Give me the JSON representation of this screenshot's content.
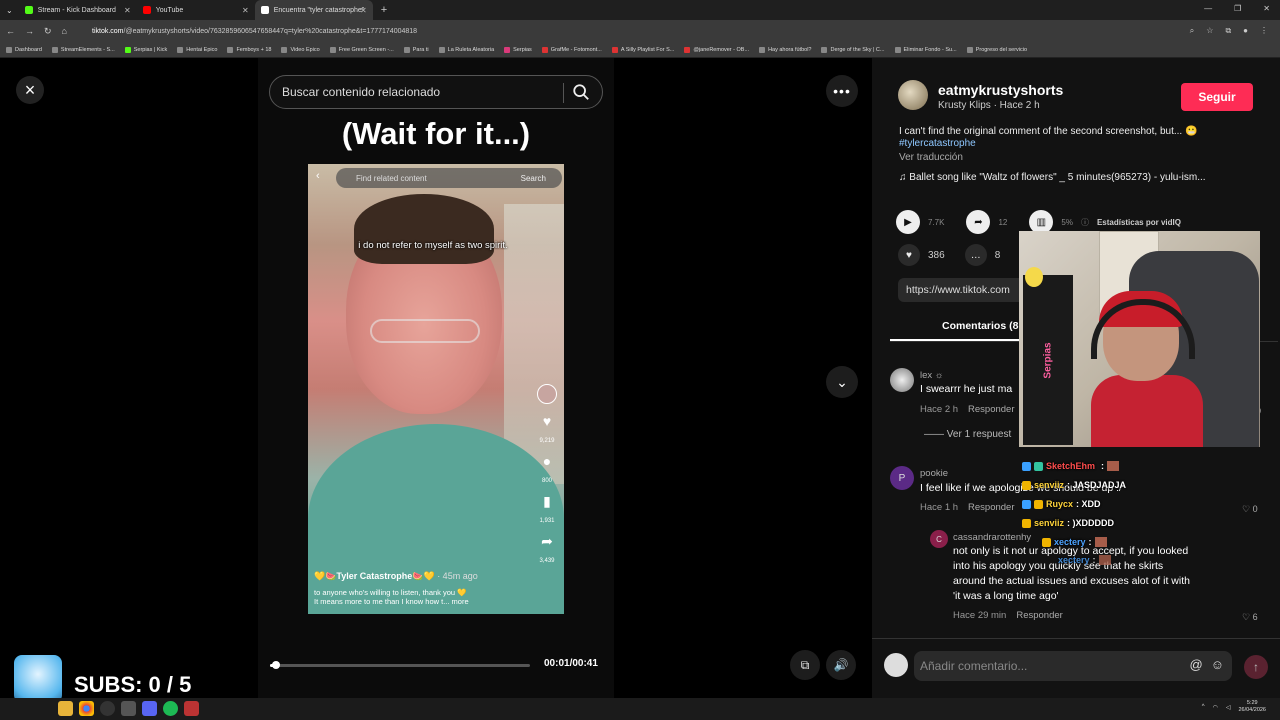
{
  "browser": {
    "tabs": [
      {
        "label": "Stream - Kick Dashboard",
        "color": "#53fc18",
        "active": false
      },
      {
        "label": "YouTube",
        "color": "#ff0000",
        "active": false
      },
      {
        "label": "Encuentra \"tyler catastrophe\"",
        "color": "#ffffff",
        "active": true
      }
    ],
    "new_tab": "+",
    "url_prefix": "tiktok.com",
    "url_rest": "/@eatmykrustyshorts/video/7632859606547658447q=tyler%20catastrophe&t=1777174004818",
    "bookmarks": [
      "Dashboard",
      "StreamElements - S...",
      "Serpias | Kick",
      "Hentai Epico",
      "Femboys + 18",
      "Video Epico",
      "Free Green Screen -...",
      "Para ti",
      "La Ruleta Aleatoria",
      "Serpias",
      "GrafMe - Fotomont...",
      "A Silly Playlist For S...",
      "@janeRemover - OB...",
      "Hay ahora fútbol?",
      "Derge of the Sky | C...",
      "Eliminar Fondo - Su...",
      "Progreso del servicio"
    ]
  },
  "player": {
    "close_icon": "×",
    "search_placeholder": "Buscar contenido relacionado",
    "title_overlay": "(Wait for it...)",
    "inner": {
      "search_placeholder": "Find related content",
      "search_button": "Search",
      "caption": "i do not refer to myself as two spirit.",
      "likes": "9,219",
      "comments": "800",
      "saves": "1,931",
      "shares": "3,439",
      "author": "💛🍉Tyler Catastrophe🍉💛",
      "author_time": " · 45m ago",
      "desc_line1": "to anyone who's willing to listen, thank you 💛",
      "desc_line2": "It means more to me than I know how t... more"
    },
    "progress": 0.024,
    "timecode": "00:01/00:41"
  },
  "panel": {
    "username": "eatmykrustyshorts",
    "subtitle": "Krusty Klips · Hace 2 h",
    "follow": "Seguir",
    "description": "I can't find the original comment of the second screenshot, but... 😬",
    "hashtag": "#tylercatastrophe",
    "translate": "Ver traducción",
    "music": "♫  Ballet song like \"Waltz of flowers\" _ 5 minutes(965273) - yulu-ism...",
    "stats": {
      "views": "7.7K",
      "shares": "12",
      "vidiq_pct": "5%",
      "vidiq_label": "Estadísticas por vidIQ",
      "likes": "386",
      "comments": "8"
    },
    "link": "https://www.tiktok.com",
    "comments_tab": "Comentarios (8",
    "comments": [
      {
        "user": "lex ☼",
        "text": "I swearrr he just ma",
        "time": "Hace 2 h",
        "reply": "Responder",
        "likes": "0",
        "replies": "Ver 1 respuest"
      },
      {
        "user": "pookie",
        "initial": "P",
        "text": "I feel like if we apologize we should be up :/",
        "time": "Hace 1 h",
        "reply": "Responder",
        "likes": "0"
      },
      {
        "user": "cassandrarottenhy",
        "initial": "C",
        "text_lines": [
          "not only is it not ur apology to accept, if you looked",
          "into his apology you quickly see that he skirts",
          "around the actual issues and excuses alot of it with",
          "'it was a long time ago'"
        ],
        "time": "Hace 29 min",
        "reply": "Responder",
        "likes": "6"
      }
    ],
    "comment_placeholder": "Añadir comentario..."
  },
  "webcam_banner": "Serpias",
  "chat": [
    {
      "user": "SketchEhm",
      "message": "",
      "color": "#ff4d4d"
    },
    {
      "user": "senviiz",
      "message": ": JASDJADJA",
      "color": "#ffd43b"
    },
    {
      "user": "Ruycx",
      "message": ": XDD",
      "color": "#ffd43b"
    },
    {
      "user": "senviiz",
      "message": ": )XDDDDD",
      "color": "#ffd43b"
    },
    {
      "user": "xectery",
      "message": ":",
      "color": "#4da3ff"
    },
    {
      "user": "xectery",
      "message": ":",
      "color": "#4da3ff"
    }
  ],
  "subs": "SUBS: 0 / 5",
  "taskbar": {
    "time": "5:29",
    "date": "26/04/2026"
  }
}
